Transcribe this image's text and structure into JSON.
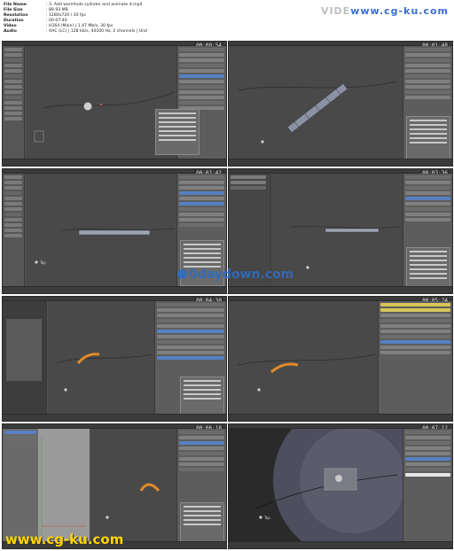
{
  "file_info": {
    "rows": [
      {
        "key": "File Name",
        "value": ": 3. Add wormhole cylinder and animate it.mp4"
      },
      {
        "key": "File Size",
        "value": ": 89.93 MB"
      },
      {
        "key": "Resolution",
        "value": ": 1280x720 / 30 fps"
      },
      {
        "key": "Duration",
        "value": ": 00:07:40"
      },
      {
        "key": "Video",
        "value": ": H264 (Main) | 1.47 Mb/s, 30 fps"
      },
      {
        "key": "Audio",
        "value": ": AAC (LC) | 128 kb/s, 44100 Hz, 2 channels | Und"
      }
    ]
  },
  "brand": {
    "prefix": "VIDE",
    "accent": "www.cg-ku.com"
  },
  "thumbnails": [
    {
      "timestamp": "00:00:54",
      "label": ""
    },
    {
      "timestamp": "00:01:48",
      "label": ""
    },
    {
      "timestamp": "00:02:42",
      "label": "Top"
    },
    {
      "timestamp": "00:03:36",
      "label": ""
    },
    {
      "timestamp": "00:04:30",
      "label": ""
    },
    {
      "timestamp": "00:05:24",
      "label": ""
    },
    {
      "timestamp": "00:06:18",
      "label": ""
    },
    {
      "timestamp": "00:07:12",
      "label": "Top"
    }
  ],
  "watermarks": {
    "middle": "0daydown.com",
    "bottom": "www.cg-ku.com"
  },
  "colors": {
    "accent_blue": "#3a6fd1",
    "watermark_yellow": "#ffd400",
    "object_orange": "#e08a2a"
  }
}
